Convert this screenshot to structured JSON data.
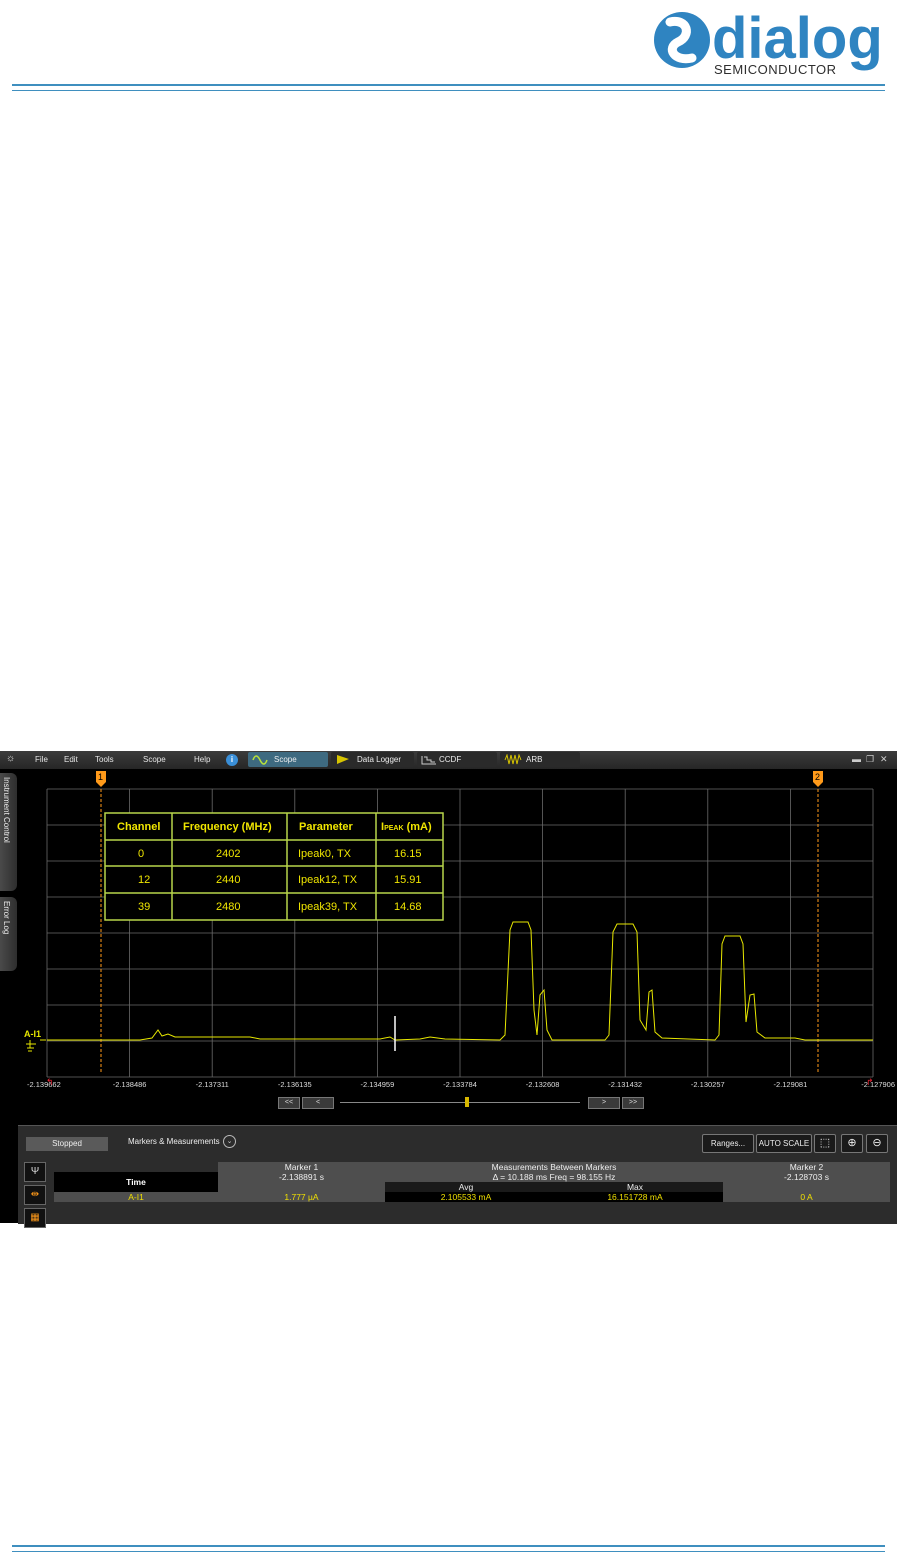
{
  "brand": {
    "name": "dialog",
    "sub": "SEMICONDUCTOR"
  },
  "menu": {
    "file": "File",
    "edit": "Edit",
    "tools": "Tools",
    "scope": "Scope",
    "help": "Help"
  },
  "tabs": [
    {
      "label": "Scope",
      "icon": "sine-wave-icon"
    },
    {
      "label": "Data Logger",
      "icon": "flag-icon"
    },
    {
      "label": "CCDF",
      "icon": "ccdf-icon"
    },
    {
      "label": "ARB",
      "icon": "arb-wave-icon"
    }
  ],
  "window_controls": {
    "min": "▬",
    "restore": "❐",
    "close": "✕"
  },
  "side_tabs": {
    "instrument": "Instrument Control",
    "errors": "Error Log"
  },
  "channel_label": "A-I1",
  "marker_labels": {
    "m1": "1",
    "m2": "2"
  },
  "table": {
    "headers": [
      "Channel",
      "Frequency (MHz)",
      "Parameter",
      "I",
      "PEAK",
      " (mA)"
    ],
    "rows": [
      {
        "channel": "0",
        "freq": "2402",
        "param": "Ipeak0, TX",
        "ipeak": "16.15"
      },
      {
        "channel": "12",
        "freq": "2440",
        "param": "Ipeak12, TX",
        "ipeak": "15.91"
      },
      {
        "channel": "39",
        "freq": "2480",
        "param": "Ipeak39, TX",
        "ipeak": "14.68"
      }
    ]
  },
  "x_ticks": [
    "-2.139662",
    "-2.138486",
    "-2.137311",
    "-2.136135",
    "-2.134959",
    "-2.133784",
    "-2.132608",
    "-2.131432",
    "-2.130257",
    "-2.129081",
    "-2.127906"
  ],
  "nav": {
    "first": "<<",
    "prev": "<",
    "next": ">",
    "last": ">>"
  },
  "bottom": {
    "status": "Stopped",
    "panel_title": "Markers & Measurements",
    "ranges": "Ranges...",
    "auto_scale": "AUTO SCALE",
    "zoom_box": "⬚",
    "zoom_in": "⊕",
    "zoom_out": "⊖"
  },
  "meas": {
    "marker1": "Marker 1",
    "between": "Measurements Between Markers",
    "marker2": "Marker 2",
    "time_label": "Time",
    "m1_time": "-2.138891 s",
    "delta": "Δ = 10.188 ms   Freq = 98.155 Hz",
    "m2_time": "-2.128703 s",
    "avg": "Avg",
    "max": "Max",
    "ch_label": "A-I1",
    "m1_val": "1.777 µA",
    "avg_val": "2.105533 mA",
    "max_val": "16.151728 mA",
    "m2_val": "0 A"
  },
  "colors": {
    "trace": "#e8e800",
    "grid": "#6a6a6a",
    "marker": "#ff9a1a",
    "table_border": "#b8d64a",
    "accent": "#3f8fbf"
  }
}
